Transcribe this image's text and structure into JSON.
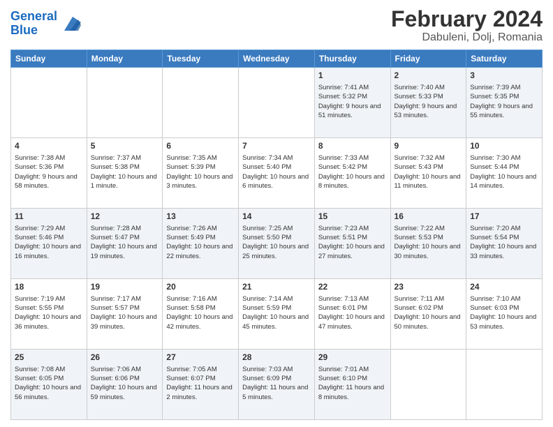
{
  "logo": {
    "line1": "General",
    "line2": "Blue"
  },
  "title": "February 2024",
  "subtitle": "Dabuleni, Dolj, Romania",
  "days_of_week": [
    "Sunday",
    "Monday",
    "Tuesday",
    "Wednesday",
    "Thursday",
    "Friday",
    "Saturday"
  ],
  "weeks": [
    [
      {
        "day": "",
        "info": ""
      },
      {
        "day": "",
        "info": ""
      },
      {
        "day": "",
        "info": ""
      },
      {
        "day": "",
        "info": ""
      },
      {
        "day": "1",
        "info": "Sunrise: 7:41 AM\nSunset: 5:32 PM\nDaylight: 9 hours and 51 minutes."
      },
      {
        "day": "2",
        "info": "Sunrise: 7:40 AM\nSunset: 5:33 PM\nDaylight: 9 hours and 53 minutes."
      },
      {
        "day": "3",
        "info": "Sunrise: 7:39 AM\nSunset: 5:35 PM\nDaylight: 9 hours and 55 minutes."
      }
    ],
    [
      {
        "day": "4",
        "info": "Sunrise: 7:38 AM\nSunset: 5:36 PM\nDaylight: 9 hours and 58 minutes."
      },
      {
        "day": "5",
        "info": "Sunrise: 7:37 AM\nSunset: 5:38 PM\nDaylight: 10 hours and 1 minute."
      },
      {
        "day": "6",
        "info": "Sunrise: 7:35 AM\nSunset: 5:39 PM\nDaylight: 10 hours and 3 minutes."
      },
      {
        "day": "7",
        "info": "Sunrise: 7:34 AM\nSunset: 5:40 PM\nDaylight: 10 hours and 6 minutes."
      },
      {
        "day": "8",
        "info": "Sunrise: 7:33 AM\nSunset: 5:42 PM\nDaylight: 10 hours and 8 minutes."
      },
      {
        "day": "9",
        "info": "Sunrise: 7:32 AM\nSunset: 5:43 PM\nDaylight: 10 hours and 11 minutes."
      },
      {
        "day": "10",
        "info": "Sunrise: 7:30 AM\nSunset: 5:44 PM\nDaylight: 10 hours and 14 minutes."
      }
    ],
    [
      {
        "day": "11",
        "info": "Sunrise: 7:29 AM\nSunset: 5:46 PM\nDaylight: 10 hours and 16 minutes."
      },
      {
        "day": "12",
        "info": "Sunrise: 7:28 AM\nSunset: 5:47 PM\nDaylight: 10 hours and 19 minutes."
      },
      {
        "day": "13",
        "info": "Sunrise: 7:26 AM\nSunset: 5:49 PM\nDaylight: 10 hours and 22 minutes."
      },
      {
        "day": "14",
        "info": "Sunrise: 7:25 AM\nSunset: 5:50 PM\nDaylight: 10 hours and 25 minutes."
      },
      {
        "day": "15",
        "info": "Sunrise: 7:23 AM\nSunset: 5:51 PM\nDaylight: 10 hours and 27 minutes."
      },
      {
        "day": "16",
        "info": "Sunrise: 7:22 AM\nSunset: 5:53 PM\nDaylight: 10 hours and 30 minutes."
      },
      {
        "day": "17",
        "info": "Sunrise: 7:20 AM\nSunset: 5:54 PM\nDaylight: 10 hours and 33 minutes."
      }
    ],
    [
      {
        "day": "18",
        "info": "Sunrise: 7:19 AM\nSunset: 5:55 PM\nDaylight: 10 hours and 36 minutes."
      },
      {
        "day": "19",
        "info": "Sunrise: 7:17 AM\nSunset: 5:57 PM\nDaylight: 10 hours and 39 minutes."
      },
      {
        "day": "20",
        "info": "Sunrise: 7:16 AM\nSunset: 5:58 PM\nDaylight: 10 hours and 42 minutes."
      },
      {
        "day": "21",
        "info": "Sunrise: 7:14 AM\nSunset: 5:59 PM\nDaylight: 10 hours and 45 minutes."
      },
      {
        "day": "22",
        "info": "Sunrise: 7:13 AM\nSunset: 6:01 PM\nDaylight: 10 hours and 47 minutes."
      },
      {
        "day": "23",
        "info": "Sunrise: 7:11 AM\nSunset: 6:02 PM\nDaylight: 10 hours and 50 minutes."
      },
      {
        "day": "24",
        "info": "Sunrise: 7:10 AM\nSunset: 6:03 PM\nDaylight: 10 hours and 53 minutes."
      }
    ],
    [
      {
        "day": "25",
        "info": "Sunrise: 7:08 AM\nSunset: 6:05 PM\nDaylight: 10 hours and 56 minutes."
      },
      {
        "day": "26",
        "info": "Sunrise: 7:06 AM\nSunset: 6:06 PM\nDaylight: 10 hours and 59 minutes."
      },
      {
        "day": "27",
        "info": "Sunrise: 7:05 AM\nSunset: 6:07 PM\nDaylight: 11 hours and 2 minutes."
      },
      {
        "day": "28",
        "info": "Sunrise: 7:03 AM\nSunset: 6:09 PM\nDaylight: 11 hours and 5 minutes."
      },
      {
        "day": "29",
        "info": "Sunrise: 7:01 AM\nSunset: 6:10 PM\nDaylight: 11 hours and 8 minutes."
      },
      {
        "day": "",
        "info": ""
      },
      {
        "day": "",
        "info": ""
      }
    ]
  ],
  "row_shades": [
    "shade",
    "white",
    "shade",
    "white",
    "shade"
  ]
}
